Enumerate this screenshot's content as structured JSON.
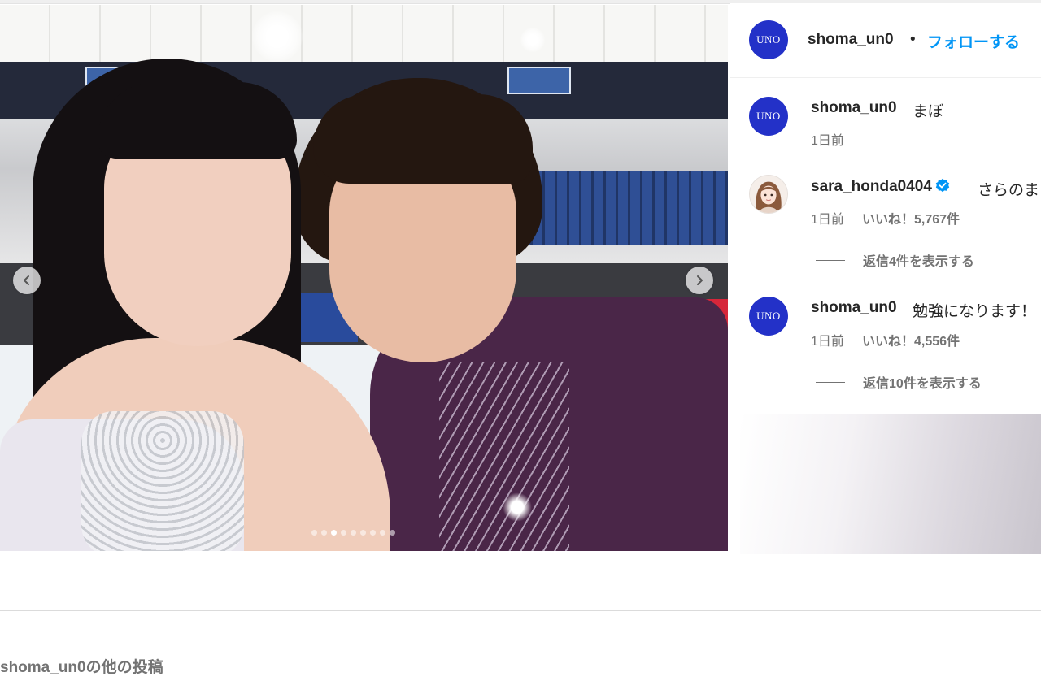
{
  "post": {
    "author": "shoma_un0",
    "follow_label": "フォローする",
    "separator": "•",
    "avatar_text": "UNO",
    "carousel": {
      "total_slides": 9,
      "active_slide": 3
    }
  },
  "comments": [
    {
      "username": "shoma_un0",
      "avatar_text": "UNO",
      "text": "まぼ",
      "time": "1日前",
      "likes": "",
      "replies": ""
    },
    {
      "username": "sara_honda0404",
      "verified": true,
      "avatar_icon": "sara-avatar-illustration",
      "text": "さらのま",
      "time": "1日前",
      "likes": "いいね！5,767件",
      "replies": "返信4件を表示する"
    },
    {
      "username": "shoma_un0",
      "avatar_text": "UNO",
      "text": "勉強になります！",
      "time": "1日前",
      "likes": "いいね！4,556件",
      "replies": "返信10件を表示する"
    }
  ],
  "footer": {
    "more_posts": "shoma_un0の他の投稿"
  },
  "colors": {
    "follow_blue": "#0095f6",
    "uno_avatar_blue": "#2331c8",
    "verified_blue": "#0095f6"
  }
}
